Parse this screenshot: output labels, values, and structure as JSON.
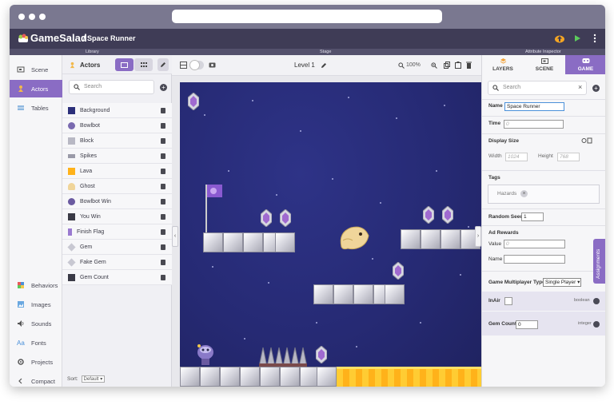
{
  "app": {
    "brand": "GameSalad",
    "project": "/ Space Runner"
  },
  "sections": {
    "library": "Library",
    "stage": "Stage",
    "inspector": "Attribute Inspector"
  },
  "leftnav": {
    "top": [
      {
        "label": "Scene",
        "icon": "scene-icon",
        "active": false
      },
      {
        "label": "Actors",
        "icon": "actors-icon",
        "active": true
      },
      {
        "label": "Tables",
        "icon": "tables-icon",
        "active": false
      }
    ],
    "bottom": [
      {
        "label": "Behaviors",
        "icon": "behaviors-icon"
      },
      {
        "label": "Images",
        "icon": "images-icon"
      },
      {
        "label": "Sounds",
        "icon": "sounds-icon"
      },
      {
        "label": "Fonts",
        "icon": "fonts-icon"
      },
      {
        "label": "Projects",
        "icon": "projects-icon"
      },
      {
        "label": "Compact",
        "icon": "chevron-left-icon"
      }
    ]
  },
  "library": {
    "title": "Actors",
    "search_placeholder": "Search",
    "actors": [
      {
        "label": "Background",
        "color": "#2b2f7a"
      },
      {
        "label": "Bowlbot",
        "color": "#7a6ab0"
      },
      {
        "label": "Block",
        "color": "#b8b8c4"
      },
      {
        "label": "Spikes",
        "color": "#9a9aa8"
      },
      {
        "label": "Lava",
        "color": "#ffb21a"
      },
      {
        "label": "Ghost",
        "color": "#f0d59a"
      },
      {
        "label": "Bowlbot Win",
        "color": "#6a5aa0"
      },
      {
        "label": "You Win",
        "color": "#3a3a46"
      },
      {
        "label": "Finish Flag",
        "color": "#9a7ad0"
      },
      {
        "label": "Gem",
        "color": "#c8c8d2"
      },
      {
        "label": "Fake Gem",
        "color": "#c8c8d2"
      },
      {
        "label": "Gem Count",
        "color": "#3a3a46"
      }
    ],
    "sort_label": "Sort:",
    "sort_value": "Default"
  },
  "stage": {
    "level": "Level 1",
    "zoom": "100%"
  },
  "inspector": {
    "tabs": [
      "LAYERS",
      "SCENE",
      "GAME"
    ],
    "active_tab": "GAME",
    "search_placeholder": "Search",
    "name_label": "Name",
    "name_value": "Space Runner",
    "time_label": "Time",
    "time_value": "0",
    "display_size_label": "Display Size",
    "width_label": "Width",
    "width_value": "1024",
    "height_label": "Height",
    "height_value": "768",
    "tags_label": "Tags",
    "tag": "Hazards",
    "random_seed_label": "Random Seed",
    "random_seed_value": "1",
    "ad_rewards_label": "Ad Rewards",
    "value_label": "Value",
    "value_value": "0",
    "reward_name_label": "Name",
    "multiplayer_label": "Game Multiplayer Type",
    "multiplayer_value": "Single Player",
    "attributes": [
      {
        "name": "InAir",
        "type": "boolean"
      },
      {
        "name": "Gem Count",
        "value": "0",
        "type": "integer"
      }
    ],
    "assignments": "Assignments"
  }
}
